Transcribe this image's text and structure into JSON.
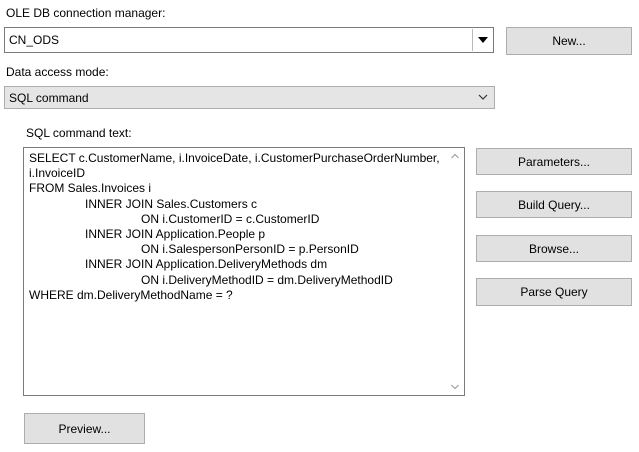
{
  "connection": {
    "label": "OLE DB connection manager:",
    "value": "CN_ODS",
    "new_button": "New..."
  },
  "access": {
    "label": "Data access mode:",
    "value": "SQL command"
  },
  "sql": {
    "label": "SQL command text:",
    "lines": [
      "SELECT c.CustomerName, i.InvoiceDate, i.CustomerPurchaseOrderNumber,",
      "i.InvoiceID",
      "FROM Sales.Invoices i",
      "INNER JOIN Sales.Customers c",
      "ON i.CustomerID = c.CustomerID",
      "INNER JOIN Application.People p",
      "ON i.SalespersonPersonID = p.PersonID",
      "INNER JOIN Application.DeliveryMethods dm",
      "ON i.DeliveryMethodID = dm.DeliveryMethodID",
      "WHERE dm.DeliveryMethodName = ?"
    ]
  },
  "buttons": {
    "parameters": "Parameters...",
    "build_query": "Build Query...",
    "browse": "Browse...",
    "parse_query": "Parse Query",
    "preview": "Preview..."
  },
  "icons": {
    "combo_arrow": "triangle-down-icon",
    "select_arrow": "chevron-down-icon",
    "scroll_up": "chevron-up-icon",
    "scroll_down": "chevron-down-icon"
  }
}
